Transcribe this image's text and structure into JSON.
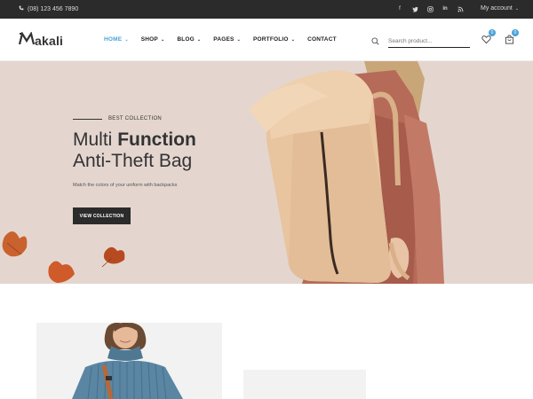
{
  "topbar": {
    "phone": "(08) 123 456 7890",
    "socials": [
      "facebook-icon",
      "twitter-icon",
      "instagram-icon",
      "linkedin-icon",
      "rss-icon"
    ],
    "account_label": "My account"
  },
  "header": {
    "logo_rest": "akali",
    "nav": [
      {
        "label": "HOME",
        "active": true,
        "has_dropdown": true
      },
      {
        "label": "SHOP",
        "active": false,
        "has_dropdown": true
      },
      {
        "label": "BLOG",
        "active": false,
        "has_dropdown": true
      },
      {
        "label": "PAGES",
        "active": false,
        "has_dropdown": true
      },
      {
        "label": "PORTFOLIO",
        "active": false,
        "has_dropdown": true
      },
      {
        "label": "CONTACT",
        "active": false,
        "has_dropdown": false
      }
    ],
    "search_placeholder": "Search product...",
    "wishlist_count": "0",
    "cart_count": "0",
    "accent_color": "#4aa3d9"
  },
  "hero": {
    "tag": "BEST COLLECTION",
    "title_light": "Multi ",
    "title_bold": "Function",
    "title_line2": "Anti-Theft Bag",
    "description": "Match the colors of your uniform with backpacks",
    "cta_label": "VIEW COLLECTION",
    "background_color": "#e4d6cf"
  }
}
